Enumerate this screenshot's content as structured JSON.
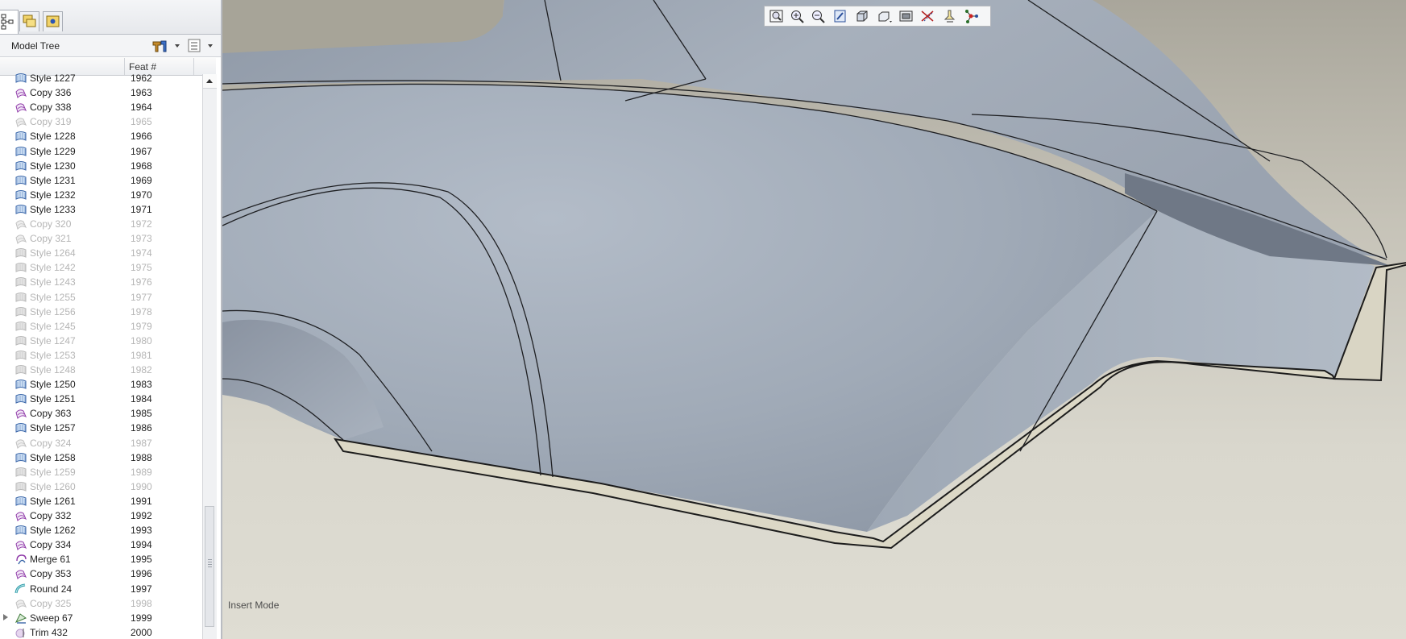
{
  "tree": {
    "title": "Model Tree",
    "columns": {
      "feat": "Feat #"
    },
    "rows": [
      {
        "name": "Style 1227",
        "feat": "1962",
        "icon": "style",
        "dim": false
      },
      {
        "name": "Copy 336",
        "feat": "1963",
        "icon": "copy",
        "dim": false
      },
      {
        "name": "Copy 338",
        "feat": "1964",
        "icon": "copy",
        "dim": false
      },
      {
        "name": "Copy 319",
        "feat": "1965",
        "icon": "copy",
        "dim": true
      },
      {
        "name": "Style 1228",
        "feat": "1966",
        "icon": "style",
        "dim": false
      },
      {
        "name": "Style 1229",
        "feat": "1967",
        "icon": "style",
        "dim": false
      },
      {
        "name": "Style 1230",
        "feat": "1968",
        "icon": "style",
        "dim": false
      },
      {
        "name": "Style 1231",
        "feat": "1969",
        "icon": "style",
        "dim": false
      },
      {
        "name": "Style 1232",
        "feat": "1970",
        "icon": "style",
        "dim": false
      },
      {
        "name": "Style 1233",
        "feat": "1971",
        "icon": "style",
        "dim": false
      },
      {
        "name": "Copy 320",
        "feat": "1972",
        "icon": "copy",
        "dim": true
      },
      {
        "name": "Copy 321",
        "feat": "1973",
        "icon": "copy",
        "dim": true
      },
      {
        "name": "Style 1264",
        "feat": "1974",
        "icon": "style",
        "dim": true
      },
      {
        "name": "Style 1242",
        "feat": "1975",
        "icon": "style",
        "dim": true
      },
      {
        "name": "Style 1243",
        "feat": "1976",
        "icon": "style",
        "dim": true
      },
      {
        "name": "Style 1255",
        "feat": "1977",
        "icon": "style",
        "dim": true
      },
      {
        "name": "Style 1256",
        "feat": "1978",
        "icon": "style",
        "dim": true
      },
      {
        "name": "Style 1245",
        "feat": "1979",
        "icon": "style",
        "dim": true
      },
      {
        "name": "Style 1247",
        "feat": "1980",
        "icon": "style",
        "dim": true
      },
      {
        "name": "Style 1253",
        "feat": "1981",
        "icon": "style",
        "dim": true
      },
      {
        "name": "Style 1248",
        "feat": "1982",
        "icon": "style",
        "dim": true
      },
      {
        "name": "Style 1250",
        "feat": "1983",
        "icon": "style",
        "dim": false
      },
      {
        "name": "Style 1251",
        "feat": "1984",
        "icon": "style",
        "dim": false
      },
      {
        "name": "Copy 363",
        "feat": "1985",
        "icon": "copy",
        "dim": false
      },
      {
        "name": "Style 1257",
        "feat": "1986",
        "icon": "style",
        "dim": false
      },
      {
        "name": "Copy 324",
        "feat": "1987",
        "icon": "copy",
        "dim": true
      },
      {
        "name": "Style 1258",
        "feat": "1988",
        "icon": "style",
        "dim": false
      },
      {
        "name": "Style 1259",
        "feat": "1989",
        "icon": "style",
        "dim": true
      },
      {
        "name": "Style 1260",
        "feat": "1990",
        "icon": "style",
        "dim": true
      },
      {
        "name": "Style 1261",
        "feat": "1991",
        "icon": "style",
        "dim": false
      },
      {
        "name": "Copy 332",
        "feat": "1992",
        "icon": "copy",
        "dim": false
      },
      {
        "name": "Style 1262",
        "feat": "1993",
        "icon": "style",
        "dim": false
      },
      {
        "name": "Copy 334",
        "feat": "1994",
        "icon": "copy",
        "dim": false
      },
      {
        "name": "Merge 61",
        "feat": "1995",
        "icon": "merge",
        "dim": false
      },
      {
        "name": "Copy 353",
        "feat": "1996",
        "icon": "copy",
        "dim": false
      },
      {
        "name": "Round 24",
        "feat": "1997",
        "icon": "round",
        "dim": false
      },
      {
        "name": "Copy 325",
        "feat": "1998",
        "icon": "copy",
        "dim": true
      },
      {
        "name": "Sweep 67",
        "feat": "1999",
        "icon": "sweep",
        "dim": false,
        "expandable": true
      },
      {
        "name": "Trim 432",
        "feat": "2000",
        "icon": "trim",
        "dim": false
      }
    ]
  },
  "toolbar": {
    "buttons": [
      "refit-icon",
      "zoom-in-icon",
      "zoom-out-icon",
      "repaint-icon",
      "display-style-icon",
      "saved-views-icon",
      "layers-icon",
      "datum-display-icon",
      "datum-planes-icon",
      "spin-center-icon"
    ]
  },
  "status": {
    "mode": "Insert Mode"
  },
  "colors": {
    "surface": "#a4adb9",
    "background": "#d8d6cc",
    "edge": "#1c1c1c"
  }
}
